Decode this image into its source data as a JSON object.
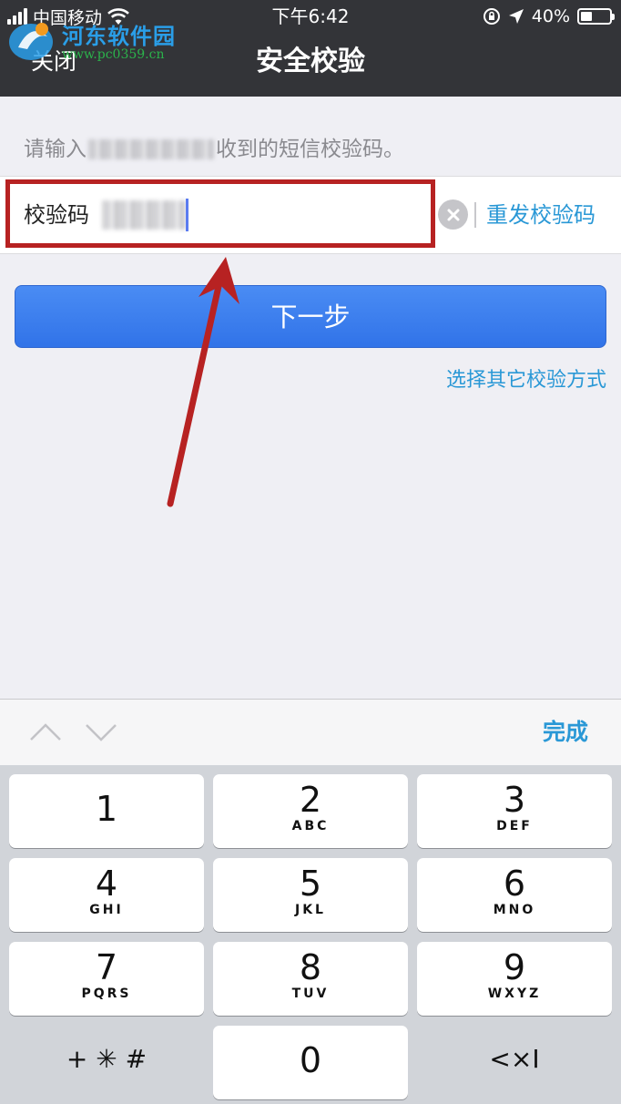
{
  "status_bar": {
    "carrier": "中国移动",
    "time": "下午6:42",
    "battery": "40%",
    "battery_level": 0.4
  },
  "watermark": {
    "name": "河东软件园",
    "url": "www.pc0359.cn"
  },
  "nav": {
    "close_label": "关闭",
    "title": "安全校验"
  },
  "content": {
    "hint_prefix": "请输入",
    "hint_suffix": "收到的短信校验码。",
    "code_label": "校验码",
    "resend_label": "重发校验码",
    "next_label": "下一步",
    "other_methods_label": "选择其它校验方式"
  },
  "accessory": {
    "done_label": "完成"
  },
  "keypad": {
    "keys": [
      {
        "num": "1",
        "letters": ""
      },
      {
        "num": "2",
        "letters": "ABC"
      },
      {
        "num": "3",
        "letters": "DEF"
      },
      {
        "num": "4",
        "letters": "GHI"
      },
      {
        "num": "5",
        "letters": "JKL"
      },
      {
        "num": "6",
        "letters": "MNO"
      },
      {
        "num": "7",
        "letters": "PQRS"
      },
      {
        "num": "8",
        "letters": "TUV"
      },
      {
        "num": "9",
        "letters": "WXYZ"
      }
    ],
    "symbols_label": "+ ✳ #",
    "zero": "0",
    "delete_label": "<×I"
  },
  "colors": {
    "accent": "#2a98d6",
    "button": "#3a7ff0",
    "highlight": "#b72222",
    "nav_bg": "#333438"
  }
}
